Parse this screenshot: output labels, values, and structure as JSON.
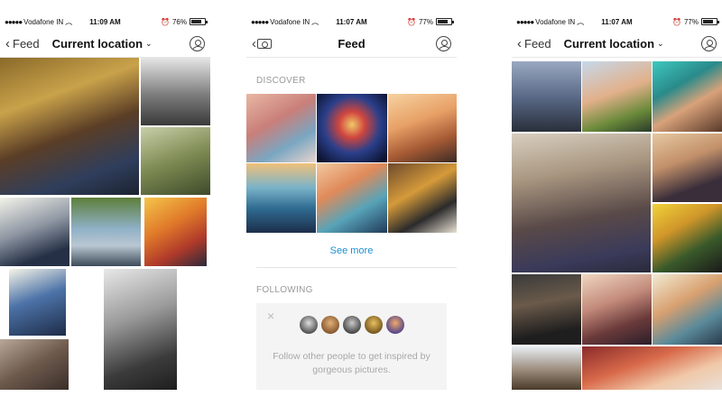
{
  "screens": [
    {
      "status": {
        "carrier": "Vodafone IN",
        "time": "11:09 AM",
        "battery": "76%",
        "battery_level": 0.76
      },
      "nav": {
        "back_label": "Feed",
        "title": "Current location"
      }
    },
    {
      "status": {
        "carrier": "Vodafone IN",
        "time": "11:07 AM",
        "battery": "77%",
        "battery_level": 0.77
      },
      "nav": {
        "title": "Feed"
      },
      "discover_label": "DISCOVER",
      "see_more": "See more",
      "following_label": "FOLLOWING",
      "follow_prompt": "Follow other people to get inspired by gorgeous pictures."
    },
    {
      "status": {
        "carrier": "Vodafone IN",
        "time": "11:07 AM",
        "battery": "77%",
        "battery_level": 0.77
      },
      "nav": {
        "back_label": "Feed",
        "title": "Current location"
      }
    }
  ],
  "icons": {
    "back": "chevron-left-icon",
    "dropdown": "chevron-down-icon",
    "profile": "user-icon",
    "camera": "camera-icon",
    "close": "close-icon",
    "wifi": "wifi-icon",
    "alarm": "alarm-icon",
    "battery": "battery-icon"
  },
  "colors": {
    "link": "#1e8fd0",
    "muted": "#999999"
  }
}
